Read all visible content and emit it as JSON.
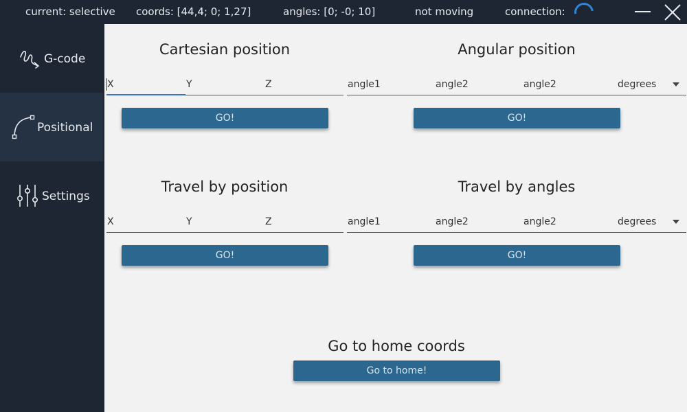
{
  "status": {
    "current": "current: selective",
    "coords": "coords: [44,4; 0; 1,27]",
    "angles": "angles: [0; -0; 10]",
    "motion": "not moving",
    "connection_label": "connection:"
  },
  "icons": {
    "connection": "loading-spinner-icon",
    "minimize": "minimize-icon",
    "close": "close-icon",
    "gcode": "gcode-squiggle-icon",
    "positional": "bezier-curve-icon",
    "settings": "sliders-icon"
  },
  "colors": {
    "sidebar_bg": "#1f2633",
    "sidebar_active": "#243244",
    "button_bg": "#2b678e",
    "accent": "#2f86d8",
    "content_bg": "#f2f2f2"
  },
  "sidebar": {
    "items": [
      {
        "label": "G-code"
      },
      {
        "label": "Positional"
      },
      {
        "label": "Settings"
      }
    ]
  },
  "cartesian": {
    "title": "Cartesian position",
    "fields": [
      "X",
      "Y",
      "Z"
    ],
    "button": "GO!"
  },
  "angular": {
    "title": "Angular position",
    "fields": [
      "angle1",
      "angle2",
      "angle2"
    ],
    "unit": "degrees",
    "button": "GO!"
  },
  "travel_position": {
    "title": "Travel by position",
    "fields": [
      "X",
      "Y",
      "Z"
    ],
    "button": "GO!"
  },
  "travel_angles": {
    "title": "Travel by angles",
    "fields": [
      "angle1",
      "angle2",
      "angle2"
    ],
    "unit": "degrees",
    "button": "GO!"
  },
  "home": {
    "title": "Go to home coords",
    "button": "Go to home!"
  }
}
